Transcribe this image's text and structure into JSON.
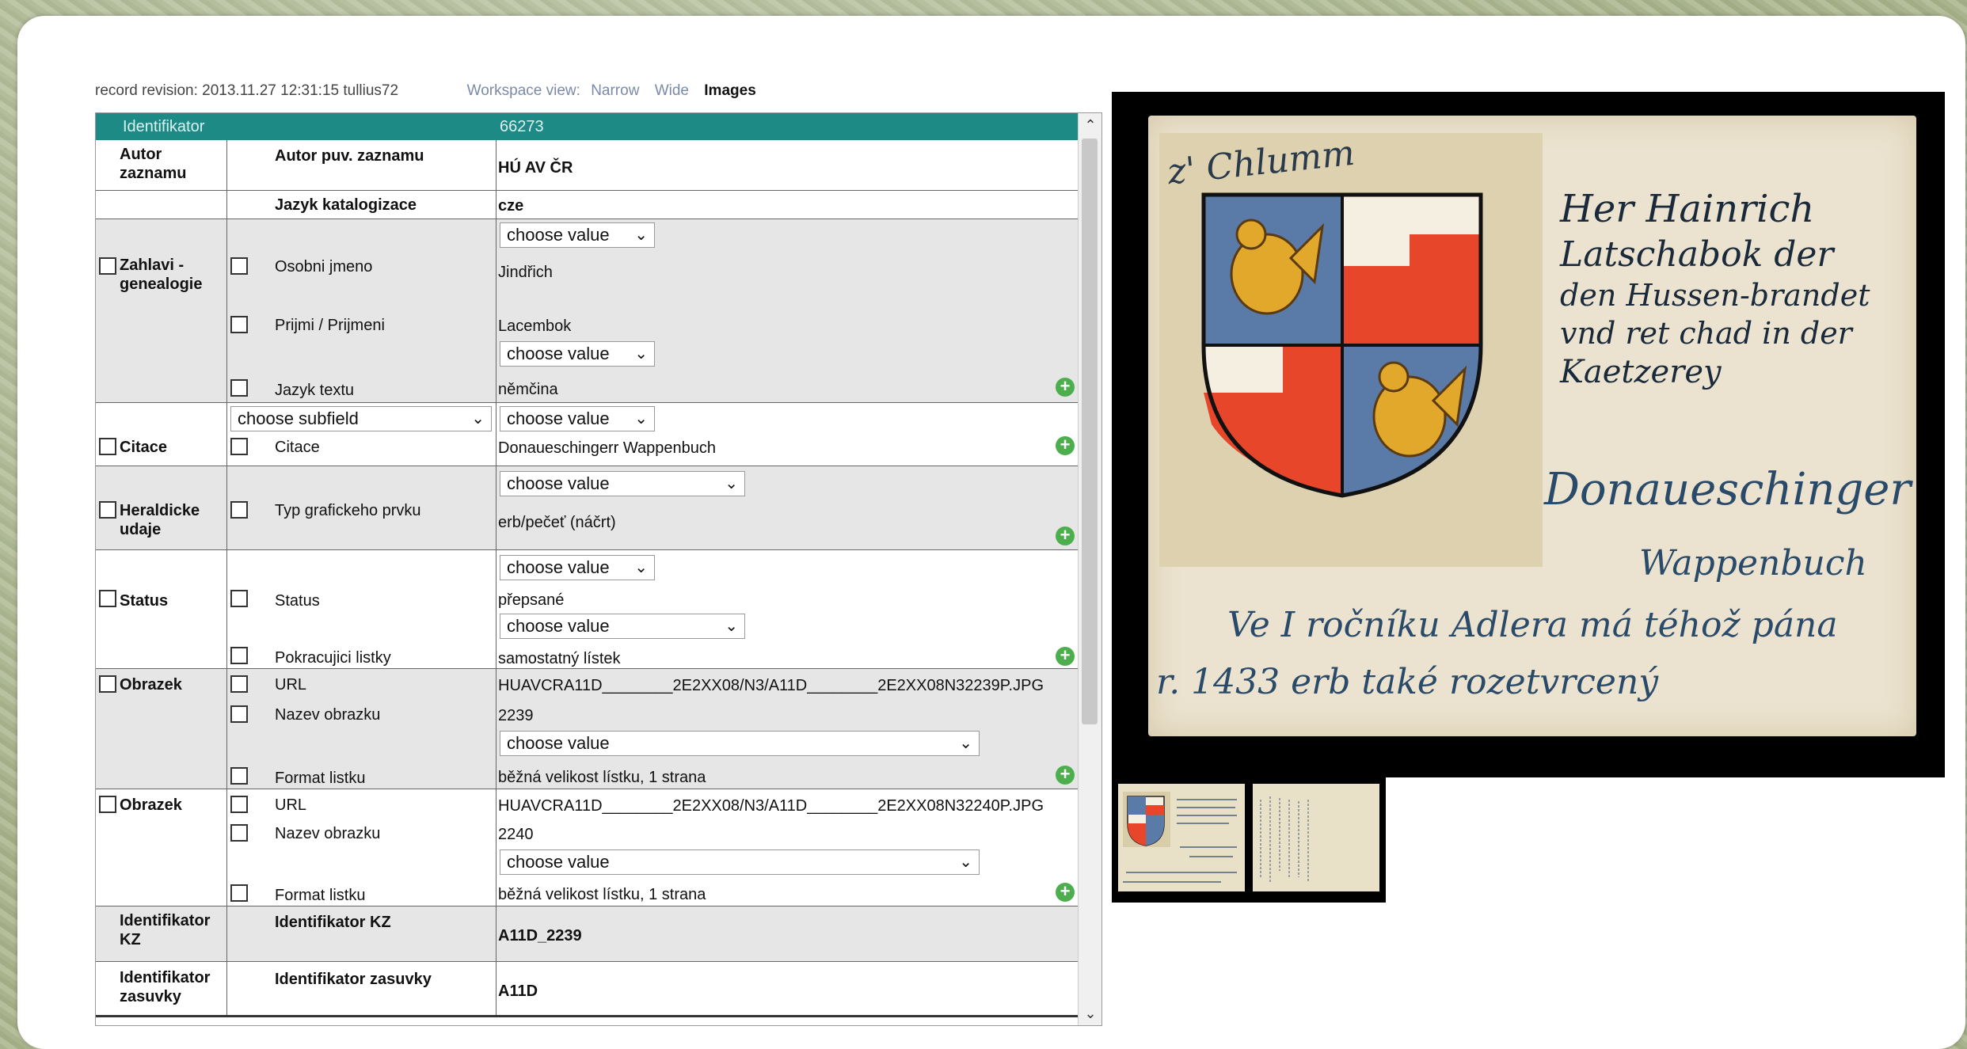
{
  "topbar": {
    "revision": "record revision: 2013.11.27 12:31:15 tullius72",
    "workspace_label": "Workspace view:",
    "narrow": "Narrow",
    "wide": "Wide",
    "images": "Images"
  },
  "form": {
    "identifier_label": "Identifikator",
    "identifier_value": "66273",
    "autor_zaznamu": "Autor zaznamu",
    "autor_puv_zaznamu": "Autor puv. zaznamu",
    "autor_value": "HÚ AV ČR",
    "jazyk_katalogizace": "Jazyk katalogizace",
    "jazyk_katalogizace_value": "cze",
    "zahlavi": "Zahlavi - genealogie",
    "choose_value": "choose value",
    "choose_subfield": "choose subfield",
    "osobni_jmeno": "Osobni jmeno",
    "osobni_jmeno_value": "Jindřich",
    "prijmi": "Prijmi / Prijmeni",
    "prijmi_value": "Lacembok",
    "jazyk_textu": "Jazyk textu",
    "jazyk_textu_value": "němčina",
    "citace": "Citace",
    "citace_value": "Donaueschingerr Wappenbuch",
    "heraldicke": "Heraldicke udaje",
    "typ_graf": "Typ grafickeho prvku",
    "typ_graf_value": "erb/pečeť (náčrt)",
    "status": "Status",
    "status_value": "přepsané",
    "pokracujici": "Pokracujici listky",
    "pokracujici_value": "samostatný lístek",
    "obrazek": "Obrazek",
    "url": "URL",
    "url1_value": "HUAVCRA11D________2E2XX08/N3/A11D________2E2XX08N32239P.JPG",
    "nazev_obrazku": "Nazev obrazku",
    "nazev1_value": "2239",
    "format_listku": "Format listku",
    "format_value": "běžná velikost lístku, 1 strana",
    "url2_value": "HUAVCRA11D________2E2XX08/N3/A11D________2E2XX08N32240P.JPG",
    "nazev2_value": "2240",
    "identifikator_kz": "Identifikator KZ",
    "identifikator_kz_value": "A11D_2239",
    "identifikator_zasuvky": "Identifikator zasuvky",
    "identifikator_zasuvky_value": "A11D"
  },
  "image": {
    "heading": "z' Chlumm",
    "text_lines": [
      "Her Hainrich",
      "Latschabok der",
      "den Hussen-brandet",
      "vnd ret chad in der",
      "Kaetzerey"
    ],
    "source": "Donaueschinger",
    "source2": "Wappenbuch",
    "bottom1": "Ve I ročníku Adlera má téhož pána",
    "bottom2": "r. 1433 erb také rozetvrcený"
  },
  "colors": {
    "header_teal": "#1e8a86",
    "shield_blue": "#5a7aa8",
    "shield_red": "#e8462a",
    "eagle_gold": "#e2a82c"
  }
}
